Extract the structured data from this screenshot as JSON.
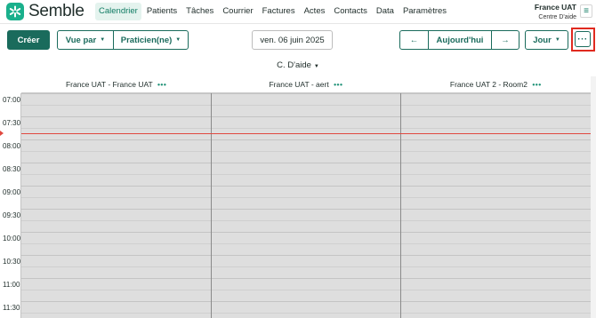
{
  "brand": {
    "name": "Semble",
    "accent": "#1ab08c",
    "primary": "#1a6b5c"
  },
  "nav": {
    "items": [
      "Calendrier",
      "Patients",
      "Tâches",
      "Courrier",
      "Factures",
      "Actes",
      "Contacts",
      "Data",
      "Paramètres"
    ],
    "active": "Calendrier"
  },
  "user": {
    "name": "France UAT",
    "practice": "Centre D'aide",
    "menu_icon": "hamburger-icon"
  },
  "toolbar": {
    "create_label": "Créer",
    "view_by_label": "Vue par",
    "practitioner_label": "Praticien(ne)",
    "date_label": "ven. 06 juin 2025",
    "prev_icon": "←",
    "today_label": "Aujourd'hui",
    "next_icon": "→",
    "period_label": "Jour",
    "more_icon": "···"
  },
  "help_label": "C. D'aide",
  "calendar": {
    "columns": [
      {
        "title": "France UAT - France UAT",
        "menu": "•••"
      },
      {
        "title": "France UAT - aert",
        "menu": "•••"
      },
      {
        "title": "France UAT 2 - Room2",
        "menu": "•••"
      }
    ],
    "times": [
      "07:00",
      "07:30",
      "08:00",
      "08:30",
      "09:00",
      "09:30",
      "10:00",
      "10:30",
      "11:00",
      "11:30"
    ],
    "current_time_color": "#e0483f"
  }
}
